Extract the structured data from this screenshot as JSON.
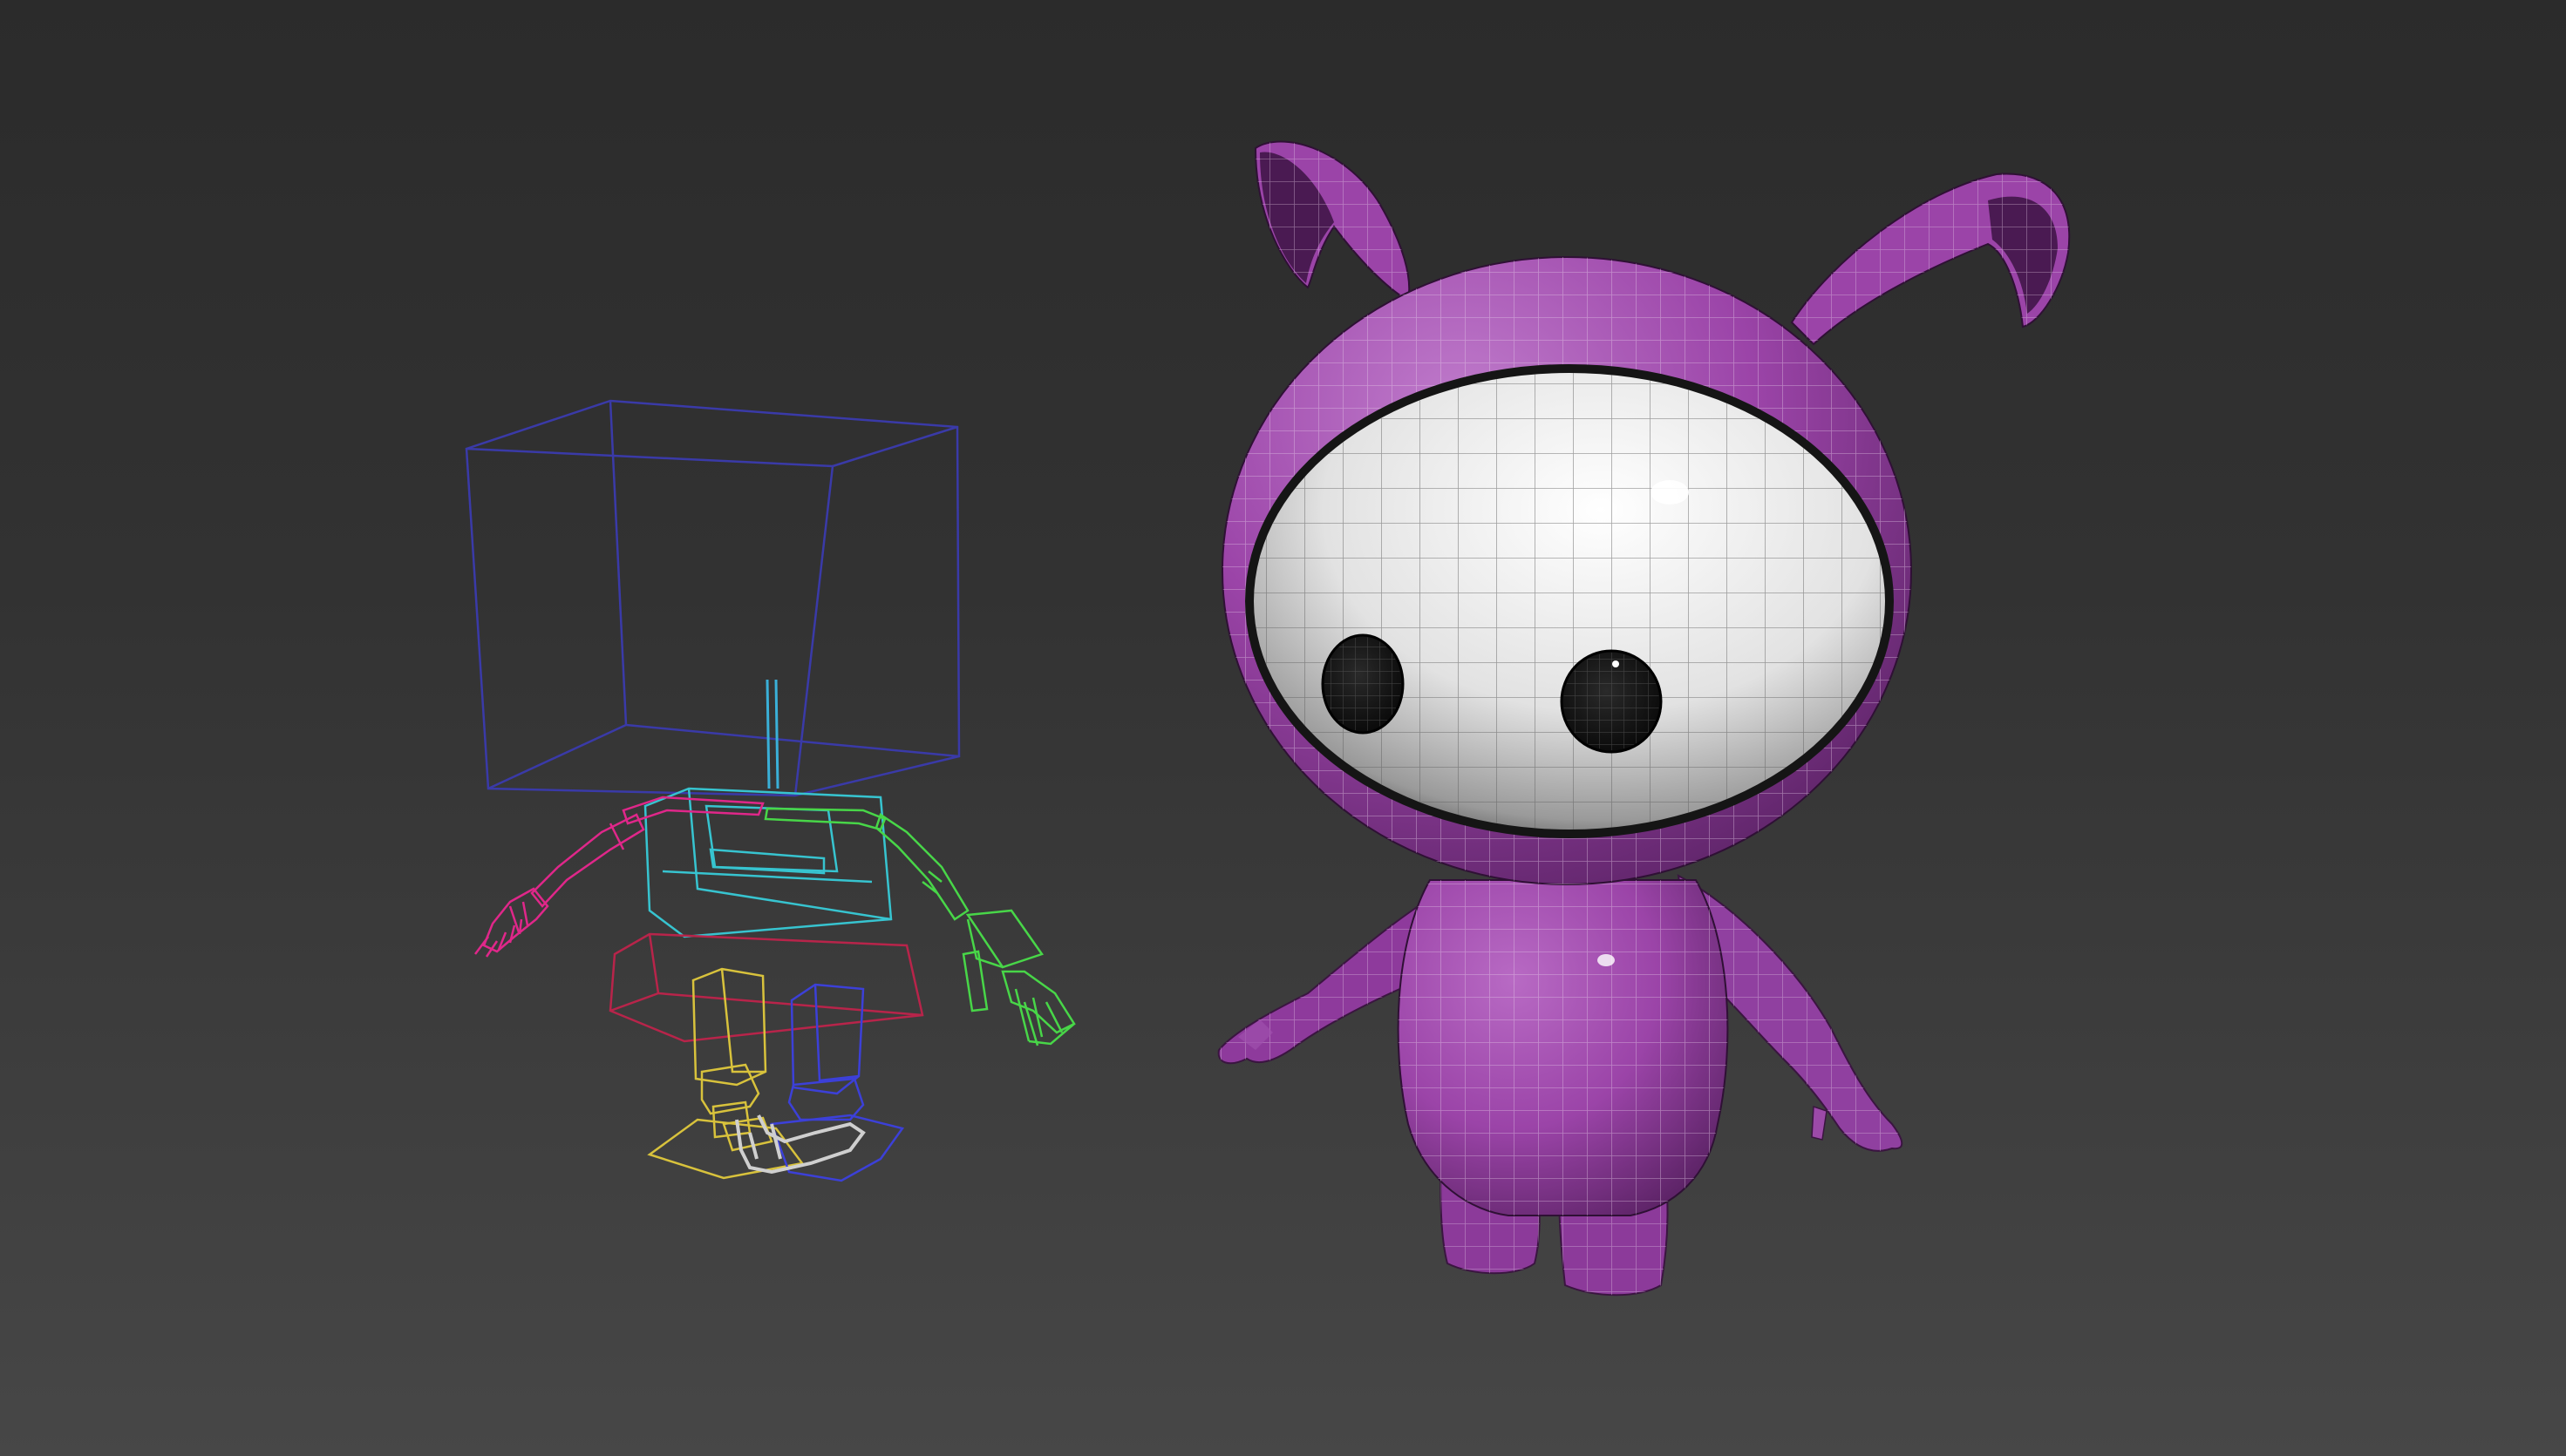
{
  "viewport": {
    "background_top": "#2b2b2b",
    "background_bottom": "#474747"
  },
  "scene": {
    "character": {
      "body_color": "#9b44a8",
      "body_shadow_color": "#5e2468",
      "face_color": "#ececec",
      "eye_color": "#0b0b0b",
      "wire_color": "#d9c8dd"
    },
    "rig": {
      "head_box_color": "#3a3aa8",
      "torso_color": "#37c4d0",
      "left_arm_color": "#e0278a",
      "right_arm_color": "#48d648",
      "pelvis_color": "#b8244a",
      "left_leg_color": "#d8c23c",
      "right_leg_color": "#3c40d8",
      "foot_color": "#cfcfcf",
      "spine_color": "#3ab0d8"
    }
  }
}
